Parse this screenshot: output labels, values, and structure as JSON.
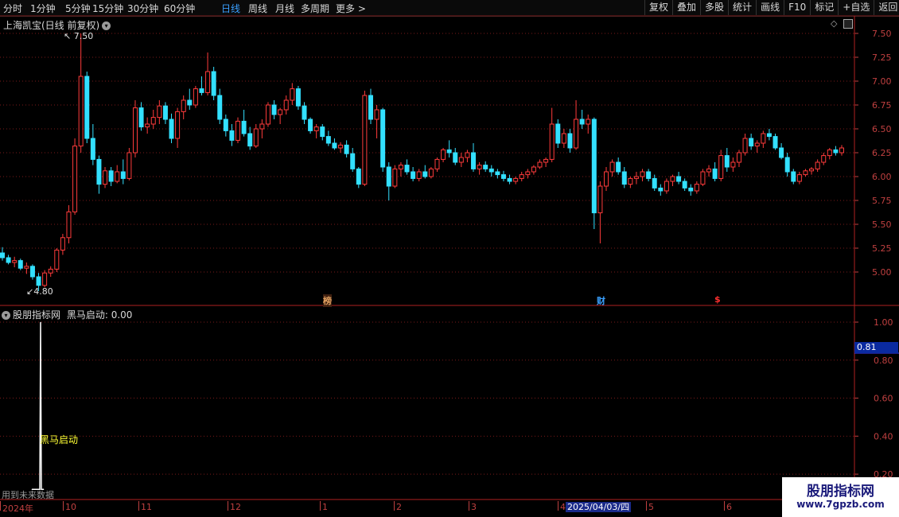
{
  "toolbar": {
    "periods": [
      "分时",
      "1分钟",
      "5分钟",
      "15分钟",
      "30分钟",
      "60分钟",
      "日线",
      "周线",
      "月线",
      "多周期",
      "更多 >"
    ],
    "active_period": "日线",
    "right_buttons": [
      "复权",
      "叠加",
      "多股",
      "统计",
      "画线",
      "F10",
      "标记",
      "+自选",
      "返回"
    ]
  },
  "main_panel": {
    "title": "上海凯宝(日线 前复权)",
    "high_label": "7.50",
    "low_label": "4.80",
    "markers": [
      {
        "text": "榜",
        "color": "#e0a060"
      },
      {
        "text": "财",
        "color": "#3aa0ff"
      },
      {
        "text": "$",
        "color": "#ff3030"
      }
    ]
  },
  "indicator_panel": {
    "name": "股朋指标网",
    "series_label": "黑马启动: 0.00",
    "signal_label": "黑马启动",
    "footer_note": "用到未来数据",
    "cursor_value": "0.81"
  },
  "colors": {
    "up": "#ff3b3b",
    "down": "#33e0ff",
    "grid": "#7a1a1a",
    "axis": "#c04040",
    "indicator_line": "#ffffff",
    "signal_text": "#ffff33"
  },
  "bottom_axis": {
    "labels": [
      "2024年",
      "10",
      "11",
      "12",
      "1",
      "2",
      "3",
      "4",
      "5",
      "6"
    ],
    "highlight": "2025/04/03/四"
  },
  "watermark": {
    "title": "股朋指标网",
    "url": "www.7gpzb.com"
  },
  "chart_data": [
    {
      "type": "candlestick",
      "title": "上海凯宝(日线 前复权)",
      "ylim": [
        4.75,
        7.6
      ],
      "y_ticks": [
        5.0,
        5.25,
        5.5,
        5.75,
        6.0,
        6.25,
        6.5,
        6.75,
        7.0,
        7.25,
        7.5
      ],
      "x_months": [
        "2024年",
        "10",
        "11",
        "12",
        "1",
        "2",
        "3",
        "4",
        "5",
        "6"
      ],
      "series": [
        {
          "name": "上海凯宝",
          "ohlc": [
            [
              5.2,
              5.26,
              5.12,
              5.15
            ],
            [
              5.15,
              5.18,
              5.08,
              5.1
            ],
            [
              5.1,
              5.16,
              5.05,
              5.12
            ],
            [
              5.12,
              5.14,
              5.02,
              5.04
            ],
            [
              5.04,
              5.1,
              4.98,
              5.06
            ],
            [
              5.06,
              5.08,
              4.92,
              4.95
            ],
            [
              4.95,
              4.99,
              4.8,
              4.86
            ],
            [
              4.86,
              5.02,
              4.84,
              4.99
            ],
            [
              4.99,
              5.06,
              4.95,
              5.03
            ],
            [
              5.03,
              5.25,
              5.0,
              5.23
            ],
            [
              5.23,
              5.4,
              5.18,
              5.36
            ],
            [
              5.36,
              5.7,
              5.3,
              5.63
            ],
            [
              5.63,
              6.4,
              5.6,
              6.32
            ],
            [
              6.32,
              7.5,
              6.25,
              7.05
            ],
            [
              7.05,
              7.1,
              6.35,
              6.4
            ],
            [
              6.4,
              6.55,
              6.12,
              6.18
            ],
            [
              6.18,
              6.22,
              5.82,
              5.92
            ],
            [
              5.92,
              6.1,
              5.88,
              6.06
            ],
            [
              6.06,
              6.1,
              5.9,
              5.95
            ],
            [
              5.95,
              6.12,
              5.93,
              6.05
            ],
            [
              6.05,
              6.18,
              5.92,
              5.98
            ],
            [
              5.98,
              6.3,
              5.96,
              6.25
            ],
            [
              6.25,
              6.8,
              6.2,
              6.72
            ],
            [
              6.72,
              6.78,
              6.48,
              6.52
            ],
            [
              6.52,
              6.62,
              6.45,
              6.55
            ],
            [
              6.55,
              6.7,
              6.5,
              6.62
            ],
            [
              6.62,
              6.8,
              6.55,
              6.74
            ],
            [
              6.74,
              6.78,
              6.55,
              6.6
            ],
            [
              6.6,
              6.66,
              6.35,
              6.4
            ],
            [
              6.4,
              6.72,
              6.3,
              6.68
            ],
            [
              6.68,
              6.85,
              6.6,
              6.8
            ],
            [
              6.8,
              6.92,
              6.7,
              6.75
            ],
            [
              6.75,
              6.95,
              6.72,
              6.92
            ],
            [
              6.92,
              7.05,
              6.85,
              6.88
            ],
            [
              6.88,
              7.3,
              6.85,
              7.1
            ],
            [
              7.1,
              7.15,
              6.8,
              6.85
            ],
            [
              6.85,
              6.92,
              6.55,
              6.6
            ],
            [
              6.6,
              6.65,
              6.42,
              6.48
            ],
            [
              6.48,
              6.55,
              6.32,
              6.38
            ],
            [
              6.38,
              6.62,
              6.35,
              6.58
            ],
            [
              6.58,
              6.7,
              6.42,
              6.45
            ],
            [
              6.45,
              6.52,
              6.28,
              6.32
            ],
            [
              6.32,
              6.55,
              6.3,
              6.5
            ],
            [
              6.5,
              6.6,
              6.4,
              6.55
            ],
            [
              6.55,
              6.78,
              6.52,
              6.75
            ],
            [
              6.75,
              6.8,
              6.6,
              6.65
            ],
            [
              6.65,
              6.72,
              6.55,
              6.7
            ],
            [
              6.7,
              6.85,
              6.65,
              6.8
            ],
            [
              6.8,
              6.98,
              6.75,
              6.92
            ],
            [
              6.92,
              6.95,
              6.7,
              6.74
            ],
            [
              6.74,
              6.78,
              6.55,
              6.6
            ],
            [
              6.6,
              6.62,
              6.45,
              6.48
            ],
            [
              6.48,
              6.55,
              6.4,
              6.52
            ],
            [
              6.52,
              6.55,
              6.38,
              6.42
            ],
            [
              6.42,
              6.48,
              6.32,
              6.35
            ],
            [
              6.35,
              6.4,
              6.28,
              6.3
            ],
            [
              6.3,
              6.36,
              6.25,
              6.33
            ],
            [
              6.33,
              6.38,
              6.2,
              6.24
            ],
            [
              6.24,
              6.3,
              6.05,
              6.08
            ],
            [
              6.08,
              6.1,
              5.88,
              5.92
            ],
            [
              5.92,
              6.9,
              5.9,
              6.85
            ],
            [
              6.85,
              6.92,
              6.55,
              6.6
            ],
            [
              6.6,
              6.75,
              6.4,
              6.7
            ],
            [
              6.7,
              6.72,
              6.05,
              6.1
            ],
            [
              6.1,
              6.15,
              5.75,
              5.9
            ],
            [
              5.9,
              6.12,
              5.88,
              6.08
            ],
            [
              6.08,
              6.15,
              6.0,
              6.12
            ],
            [
              6.12,
              6.18,
              6.02,
              6.05
            ],
            [
              6.05,
              6.1,
              5.95,
              5.98
            ],
            [
              5.98,
              6.08,
              5.95,
              6.05
            ],
            [
              6.05,
              6.12,
              5.98,
              6.0
            ],
            [
              6.0,
              6.1,
              5.98,
              6.08
            ],
            [
              6.08,
              6.2,
              6.05,
              6.18
            ],
            [
              6.18,
              6.3,
              6.15,
              6.28
            ],
            [
              6.28,
              6.38,
              6.2,
              6.25
            ],
            [
              6.25,
              6.3,
              6.12,
              6.15
            ],
            [
              6.15,
              6.25,
              6.1,
              6.2
            ],
            [
              6.2,
              6.28,
              6.15,
              6.25
            ],
            [
              6.25,
              6.35,
              6.05,
              6.08
            ],
            [
              6.08,
              6.15,
              6.02,
              6.12
            ],
            [
              6.12,
              6.16,
              6.05,
              6.08
            ],
            [
              6.08,
              6.12,
              6.0,
              6.05
            ],
            [
              6.05,
              6.08,
              5.98,
              6.02
            ],
            [
              6.02,
              6.06,
              5.95,
              5.98
            ],
            [
              5.98,
              6.02,
              5.92,
              5.95
            ],
            [
              5.95,
              6.0,
              5.92,
              5.98
            ],
            [
              5.98,
              6.05,
              5.95,
              6.02
            ],
            [
              6.02,
              6.08,
              5.98,
              6.05
            ],
            [
              6.05,
              6.12,
              6.02,
              6.1
            ],
            [
              6.1,
              6.18,
              6.08,
              6.15
            ],
            [
              6.15,
              6.2,
              6.1,
              6.18
            ],
            [
              6.18,
              6.72,
              6.15,
              6.55
            ],
            [
              6.55,
              6.6,
              6.3,
              6.35
            ],
            [
              6.35,
              6.5,
              6.3,
              6.45
            ],
            [
              6.45,
              6.5,
              6.25,
              6.3
            ],
            [
              6.3,
              6.8,
              6.28,
              6.6
            ],
            [
              6.6,
              6.7,
              6.5,
              6.55
            ],
            [
              6.55,
              6.65,
              6.45,
              6.6
            ],
            [
              6.6,
              6.62,
              5.45,
              5.62
            ],
            [
              5.62,
              5.95,
              5.3,
              5.9
            ],
            [
              5.9,
              6.1,
              5.85,
              6.05
            ],
            [
              6.05,
              6.18,
              6.0,
              6.15
            ],
            [
              6.15,
              6.2,
              6.02,
              6.05
            ],
            [
              6.05,
              6.1,
              5.88,
              5.92
            ],
            [
              5.92,
              6.0,
              5.88,
              5.98
            ],
            [
              5.98,
              6.05,
              5.92,
              6.0
            ],
            [
              6.0,
              6.08,
              5.95,
              6.05
            ],
            [
              6.05,
              6.08,
              5.95,
              5.98
            ],
            [
              5.98,
              6.02,
              5.85,
              5.88
            ],
            [
              5.88,
              5.92,
              5.8,
              5.85
            ],
            [
              5.85,
              5.98,
              5.82,
              5.95
            ],
            [
              5.95,
              6.02,
              5.9,
              6.0
            ],
            [
              6.0,
              6.05,
              5.92,
              5.95
            ],
            [
              5.95,
              5.98,
              5.85,
              5.88
            ],
            [
              5.88,
              5.92,
              5.8,
              5.85
            ],
            [
              5.85,
              5.95,
              5.82,
              5.92
            ],
            [
              5.92,
              6.08,
              5.9,
              6.05
            ],
            [
              6.05,
              6.12,
              6.0,
              6.08
            ],
            [
              6.08,
              6.15,
              5.95,
              5.98
            ],
            [
              5.98,
              6.28,
              5.95,
              6.22
            ],
            [
              6.22,
              6.3,
              6.05,
              6.1
            ],
            [
              6.1,
              6.2,
              6.05,
              6.15
            ],
            [
              6.15,
              6.28,
              6.1,
              6.25
            ],
            [
              6.25,
              6.45,
              6.22,
              6.4
            ],
            [
              6.4,
              6.45,
              6.28,
              6.32
            ],
            [
              6.32,
              6.38,
              6.25,
              6.35
            ],
            [
              6.35,
              6.48,
              6.3,
              6.45
            ],
            [
              6.45,
              6.5,
              6.38,
              6.42
            ],
            [
              6.42,
              6.45,
              6.28,
              6.3
            ],
            [
              6.3,
              6.35,
              6.18,
              6.2
            ],
            [
              6.2,
              6.25,
              6.0,
              6.05
            ],
            [
              6.05,
              6.08,
              5.92,
              5.95
            ],
            [
              5.95,
              6.05,
              5.92,
              6.02
            ],
            [
              6.02,
              6.08,
              6.0,
              6.06
            ],
            [
              6.06,
              6.1,
              6.02,
              6.08
            ],
            [
              6.08,
              6.18,
              6.05,
              6.15
            ],
            [
              6.15,
              6.25,
              6.12,
              6.22
            ],
            [
              6.22,
              6.3,
              6.18,
              6.28
            ],
            [
              6.28,
              6.32,
              6.22,
              6.25
            ],
            [
              6.25,
              6.33,
              6.22,
              6.3
            ]
          ]
        }
      ]
    },
    {
      "type": "line",
      "title": "股朋指标网 黑马启动",
      "ylim": [
        0.1,
        1.05
      ],
      "y_ticks": [
        0.2,
        0.4,
        0.6,
        0.8,
        1.0
      ],
      "series": [
        {
          "name": "黑马启动",
          "values": [
            0.12,
            0.12,
            0.12,
            0.12,
            0.12,
            0.12,
            0.12,
            0.12,
            0.12,
            0.12,
            0.12,
            1.0,
            0.12,
            0.12,
            0.12,
            0.12
          ]
        }
      ]
    }
  ]
}
